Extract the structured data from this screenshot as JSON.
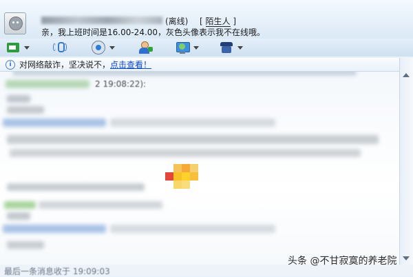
{
  "header": {
    "status": "(离线)",
    "relation_open": "[ ",
    "relation": "陌生人",
    "relation_close": " ]",
    "signature": "亲，我上班时间是16.00-24.00，灰色头像表示我不在线哦。"
  },
  "toolbar": {
    "items": [
      {
        "icon": "contact-icon"
      },
      {
        "icon": "voice-icon"
      },
      {
        "icon": "video-icon"
      },
      {
        "icon": "add-friend-icon"
      },
      {
        "icon": "app-icon"
      },
      {
        "icon": "more-icon"
      }
    ]
  },
  "notice": {
    "text": "对网络敲诈，坚决说不，",
    "link": "点击查看！"
  },
  "chat": {
    "message_time": "2 19:08:22):"
  },
  "footer": {
    "last_message": "最后一条消息收于 19:09:03"
  },
  "watermark": "头条 @不甘寂寞的养老院",
  "colors": {
    "link": "#0b47c4",
    "accent": "#2f6db8",
    "header_bg": "#dbe9f6"
  }
}
